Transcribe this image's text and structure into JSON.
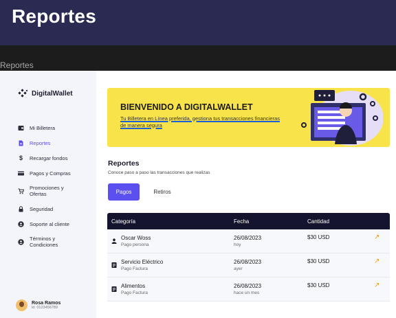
{
  "header": {
    "title": "Reportes"
  },
  "breadcrumb": "Reportes",
  "sidebar": {
    "brand": "DigitalWallet",
    "items": [
      {
        "label": "Mi Billetera",
        "icon": "wallet-icon"
      },
      {
        "label": "Reportes",
        "icon": "report-icon",
        "active": true
      },
      {
        "label": "Recargar fondos",
        "icon": "dollar-icon"
      },
      {
        "label": "Pagos y Compras",
        "icon": "card-icon"
      },
      {
        "label": "Promociones y Ofertas",
        "icon": "cart-icon"
      },
      {
        "label": "Seguridad",
        "icon": "lock-icon"
      },
      {
        "label": "Soporte al cliente",
        "icon": "support-icon"
      },
      {
        "label": "Términos y Condiciones",
        "icon": "info-icon"
      }
    ],
    "user": {
      "name": "Rosa Ramos",
      "id": "id: 0123456789"
    }
  },
  "banner": {
    "title": "BIENVENIDO A DIGITALWALLET",
    "subtitle": "Tu Billetera en Línea preferida, gestiona tus transacciones financieras de manera segura"
  },
  "reports": {
    "title": "Reportes",
    "subtitle": "Conoce paso a paso las transacciones que realizas",
    "tabs": [
      "Pagos",
      "Retiros"
    ]
  },
  "table": {
    "headers": [
      "Categoría",
      "Fecha",
      "Cantidad"
    ],
    "rows": [
      {
        "name": "Oscar Woss",
        "sub": "Pago persona",
        "date": "26/08/2023",
        "when": "hoy",
        "amount": "$30 USD",
        "icon": "person-icon"
      },
      {
        "name": "Servicio Eléctrico",
        "sub": "Pago Factura",
        "date": "26/08/2023",
        "when": "ayer",
        "amount": "$30 USD",
        "icon": "invoice-icon"
      },
      {
        "name": "Alimentos",
        "sub": "Pago Factura",
        "date": "26/08/2023",
        "when": "hace un mes",
        "amount": "$30 USD",
        "icon": "invoice-icon"
      }
    ]
  },
  "colors": {
    "accent": "#5b4ff0",
    "banner": "#f8e44a",
    "header": "#2a2a52",
    "table_head": "#14142e",
    "arrow": "#e89d16"
  }
}
